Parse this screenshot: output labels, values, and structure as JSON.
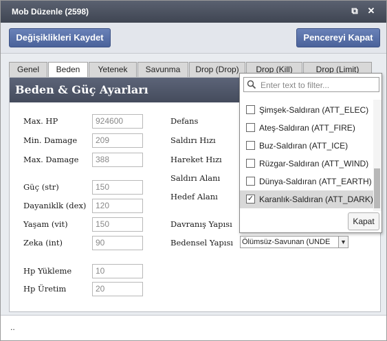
{
  "window": {
    "title": "Mob Düzenle (2598)"
  },
  "toolbar": {
    "save_label": "Değişiklikleri Kaydet",
    "close_label": "Pencereyi Kapat"
  },
  "tabs": [
    "Genel",
    "Beden",
    "Yetenek",
    "Savunma",
    "Drop (Drop)",
    "Drop (Kill)",
    "Drop (Limit)"
  ],
  "active_tab": "Beden",
  "section": {
    "title": "Beden & Güç Ayarları"
  },
  "left_fields": [
    {
      "label": "Max. HP",
      "value": "924600"
    },
    {
      "label": "Min. Damage",
      "value": "209"
    },
    {
      "label": "Max. Damage",
      "value": "388"
    },
    {
      "label": "Güç (str)",
      "value": "150"
    },
    {
      "label": "Dayaniklk (dex)",
      "value": "120"
    },
    {
      "label": "Yaşam (vit)",
      "value": "150"
    },
    {
      "label": "Zeka (int)",
      "value": "90"
    },
    {
      "label": "Hp Yükleme",
      "value": "10"
    },
    {
      "label": "Hp Üretim",
      "value": "20"
    }
  ],
  "right_fields": [
    {
      "label": "Defans"
    },
    {
      "label": "Saldırı Hızı"
    },
    {
      "label": "Hareket Hızı"
    },
    {
      "label": "Saldırı Alanı"
    },
    {
      "label": "Hedef Alanı"
    },
    {
      "label": "Davranış Yapısı"
    },
    {
      "label": "Bedensel Yapısı",
      "value": "Ölümsüz-Savunan (UNDE"
    }
  ],
  "popup": {
    "filter_placeholder": "Enter text to filter...",
    "options": [
      {
        "label": "Şimşek-Saldıran (ATT_ELEC)",
        "checked": false
      },
      {
        "label": "Ateş-Saldıran (ATT_FIRE)",
        "checked": false
      },
      {
        "label": "Buz-Saldıran (ATT_ICE)",
        "checked": false
      },
      {
        "label": "Rüzgar-Saldıran (ATT_WIND)",
        "checked": false
      },
      {
        "label": "Dünya-Saldıran (ATT_EARTH)",
        "checked": false
      },
      {
        "label": "Karanlık-Saldıran (ATT_DARK)",
        "checked": true
      }
    ],
    "close_label": "Kapat"
  },
  "status": {
    "text": ".."
  },
  "colors": {
    "titlebar": "#4a505e",
    "button": "#5a72aa",
    "section_header": "#505870"
  },
  "icons": {
    "restore": "restore-icon",
    "close": "close-icon",
    "search": "search-icon",
    "dropdown": "chevron-down-icon"
  }
}
